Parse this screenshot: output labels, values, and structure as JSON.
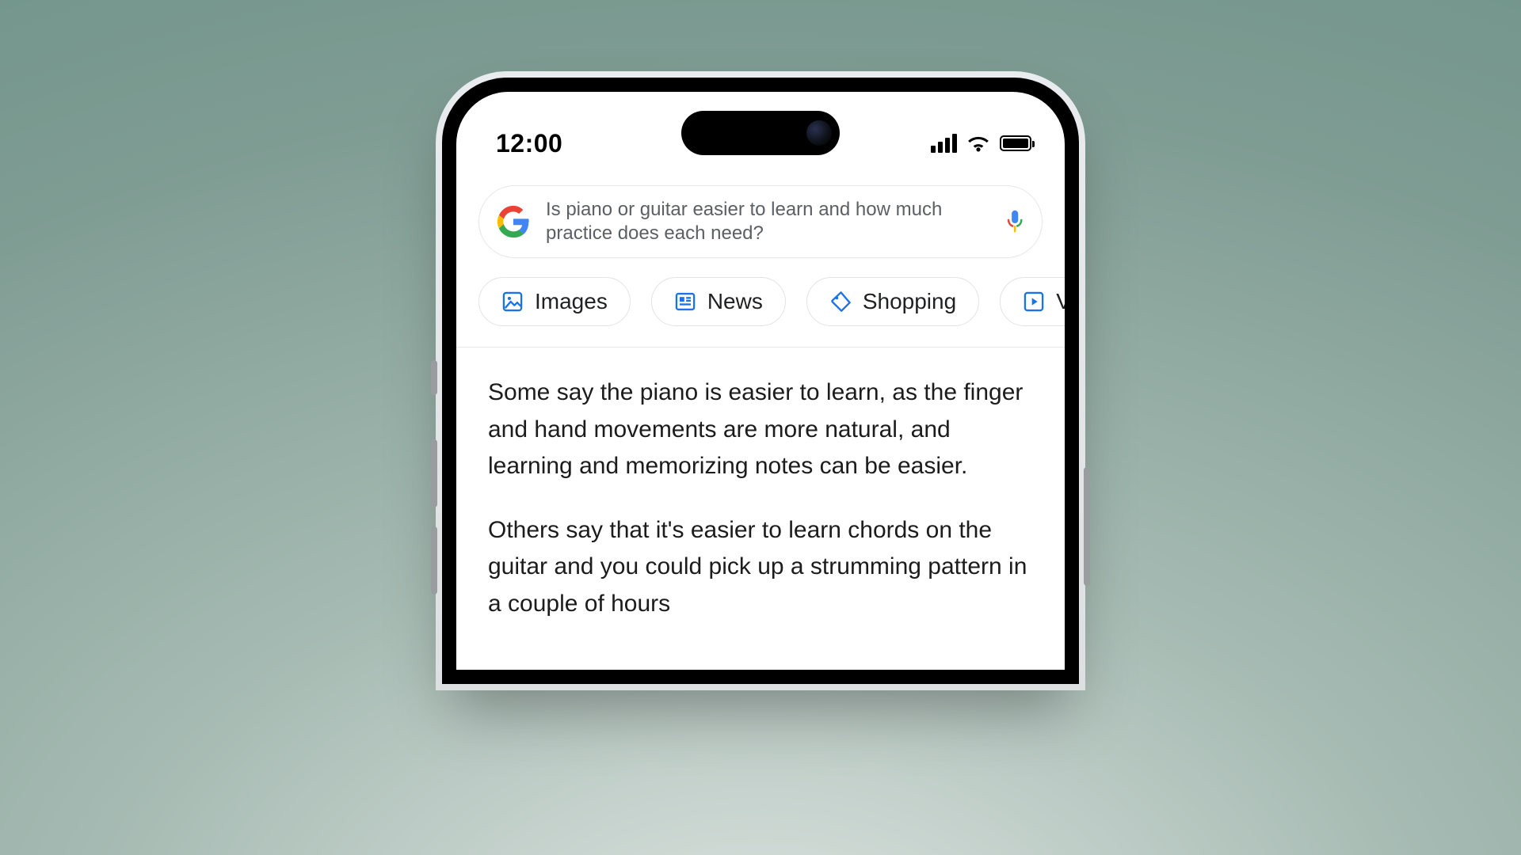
{
  "status": {
    "time": "12:00"
  },
  "search": {
    "query": "Is piano or guitar easier to learn and how much practice does each need?"
  },
  "tabs": [
    {
      "label": "Images"
    },
    {
      "label": "News"
    },
    {
      "label": "Shopping"
    },
    {
      "label": "Vide"
    }
  ],
  "results": {
    "p1": "Some say the piano is easier to learn, as the finger and hand movements are more natural, and learning and memorizing notes can be easier.",
    "p2": "Others say that it's easier to learn chords on the guitar and you could pick up a strumming pattern in a couple of hours"
  }
}
